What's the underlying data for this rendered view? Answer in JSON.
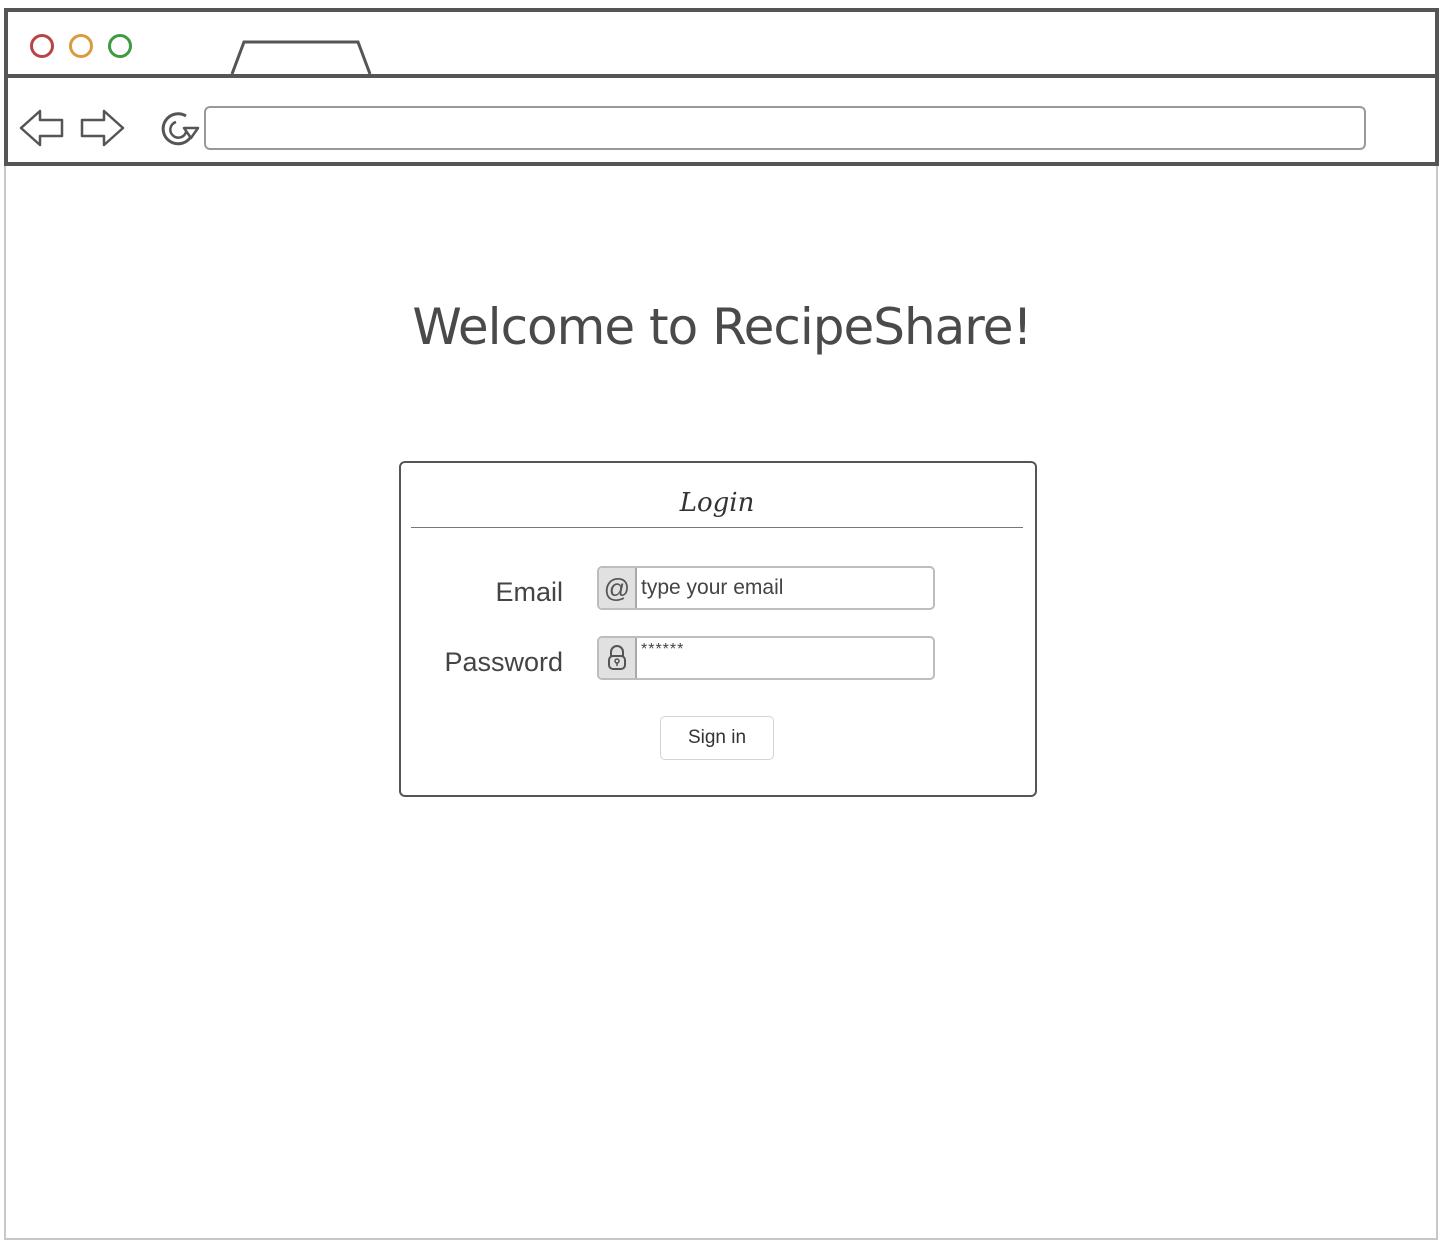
{
  "page": {
    "title": "Welcome to RecipeShare!"
  },
  "browser": {
    "url": "",
    "icons": {
      "close": "red-circle-icon",
      "minimize": "yellow-circle-icon",
      "maximize": "green-circle-icon",
      "back": "back-arrow-icon",
      "forward": "forward-arrow-icon",
      "reload": "reload-icon"
    },
    "colors": {
      "close": "#b84545",
      "minimize": "#d99b3b",
      "maximize": "#3f9b3f"
    }
  },
  "login": {
    "header": "Login",
    "email": {
      "label": "Email",
      "placeholder": "type your email",
      "addon_icon": "at-sign-icon",
      "addon_text": "@"
    },
    "password": {
      "label": "Password",
      "value": "******",
      "addon_icon": "lock-icon"
    },
    "signin_label": "Sign in"
  }
}
